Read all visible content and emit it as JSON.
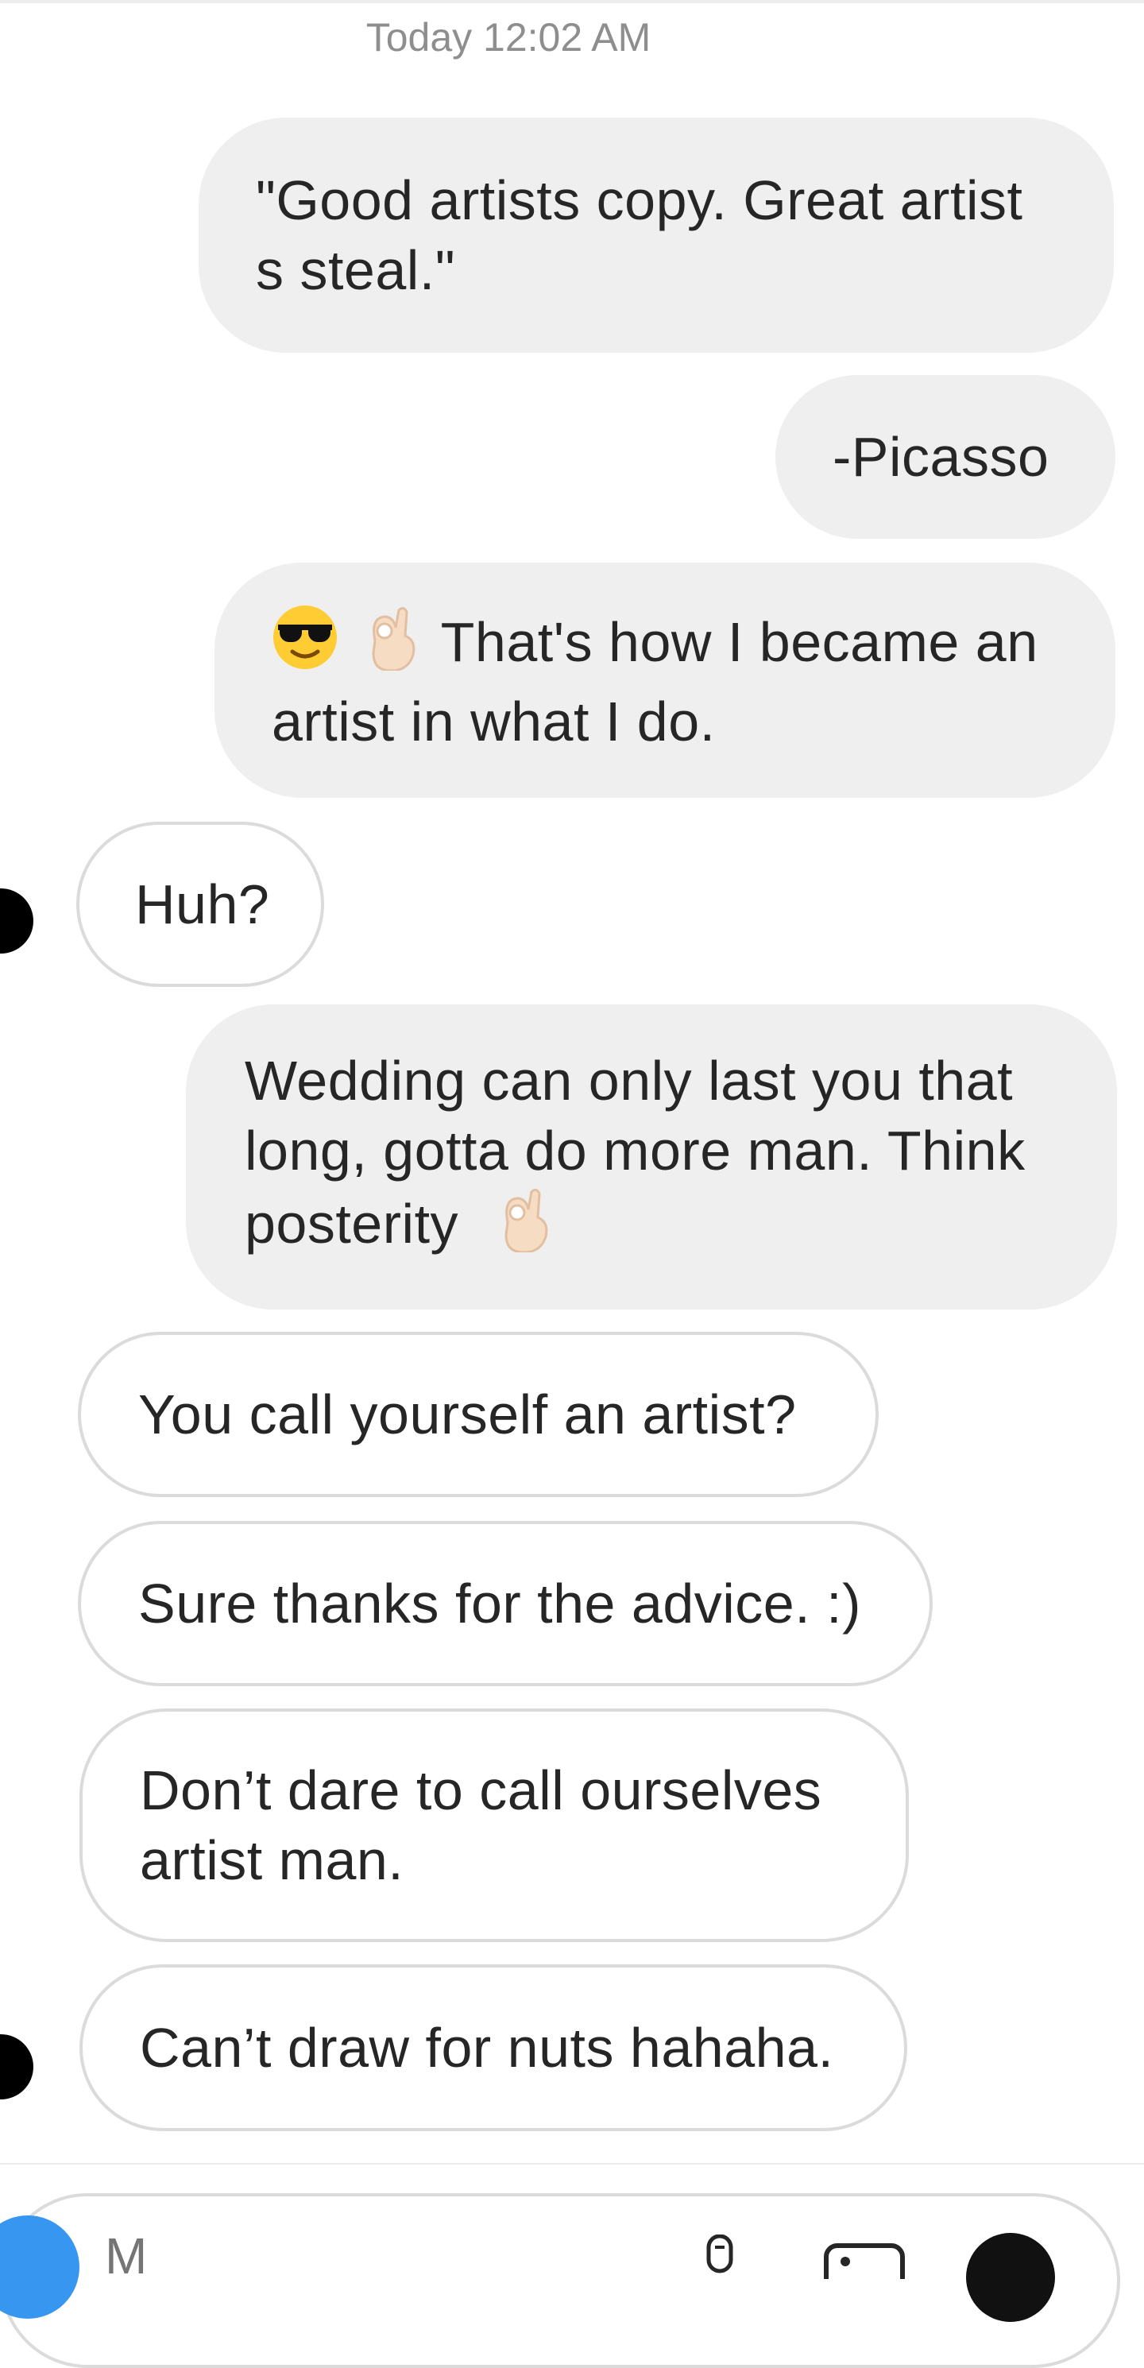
{
  "timestamp": "Today 12:02 AM",
  "messages": [
    {
      "from": "me",
      "lines": [
        "\"Good artists copy. Great artist",
        "s steal.\""
      ]
    },
    {
      "from": "me",
      "lines": [
        "-Picasso"
      ]
    },
    {
      "from": "me",
      "emojis": [
        "sunglasses-emoji",
        "ok-hand-emoji"
      ],
      "lines": [
        "That's how I became an",
        "artist in what I do."
      ]
    },
    {
      "from": "them",
      "lines": [
        "Huh?"
      ]
    },
    {
      "from": "me",
      "lines": [
        "Wedding can only last you that",
        "long, gotta do more man. Think",
        "posterity"
      ],
      "trailing_emoji": "ok-hand-emoji"
    },
    {
      "from": "them",
      "lines": [
        "You call yourself an artist?"
      ]
    },
    {
      "from": "them",
      "lines": [
        "Sure thanks for the advice. :)"
      ]
    },
    {
      "from": "them",
      "lines": [
        "Don’t dare to call ourselves",
        "artist man."
      ]
    },
    {
      "from": "them",
      "lines": [
        "Can’t draw for nuts hahaha."
      ]
    }
  ],
  "composer": {
    "placeholder": "M",
    "icons": [
      "camera-icon",
      "microphone-icon",
      "gallery-icon",
      "sticker-icon"
    ]
  },
  "colors": {
    "sent_bubble": "#efefef",
    "received_border": "#dbdbdb",
    "accent": "#3797f0",
    "timestamp": "#8e8e8e"
  }
}
